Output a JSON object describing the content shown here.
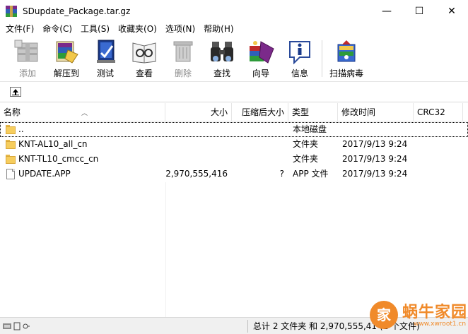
{
  "window": {
    "title": "SDupdate_Package.tar.gz",
    "minimize": "—",
    "maximize": "☐",
    "close": "✕"
  },
  "menu": [
    "文件(F)",
    "命令(C)",
    "工具(S)",
    "收藏夹(O)",
    "选项(N)",
    "帮助(H)"
  ],
  "toolbar": {
    "add": "添加",
    "extract": "解压到",
    "test": "测试",
    "view": "查看",
    "delete": "删除",
    "find": "查找",
    "wizard": "向导",
    "info": "信息",
    "scan": "扫描病毒"
  },
  "columns": {
    "name": "名称",
    "size": "大小",
    "packed": "压缩后大小",
    "type": "类型",
    "modified": "修改时间",
    "crc": "CRC32"
  },
  "rows": [
    {
      "name": "..",
      "size": "",
      "packed": "",
      "type": "本地磁盘",
      "modified": "",
      "crc": ""
    },
    {
      "name": "KNT-AL10_all_cn",
      "size": "",
      "packed": "",
      "type": "文件夹",
      "modified": "2017/9/13 9:24",
      "crc": ""
    },
    {
      "name": "KNT-TL10_cmcc_cn",
      "size": "",
      "packed": "",
      "type": "文件夹",
      "modified": "2017/9/13 9:24",
      "crc": ""
    },
    {
      "name": "UPDATE.APP",
      "size": "2,970,555,416",
      "packed": "?",
      "type": "APP 文件",
      "modified": "2017/9/13 9:24",
      "crc": ""
    }
  ],
  "status": {
    "summary": "总计 2 文件夹 和 2,970,555,41",
    "suffix": "(1 个文件)"
  },
  "watermark": {
    "logo_char": "家",
    "brand": "蜗牛家园",
    "url": "www.xwroot1.cn"
  },
  "colors": {
    "accent": "#f08a2a",
    "folder": "#f6cd5d"
  }
}
